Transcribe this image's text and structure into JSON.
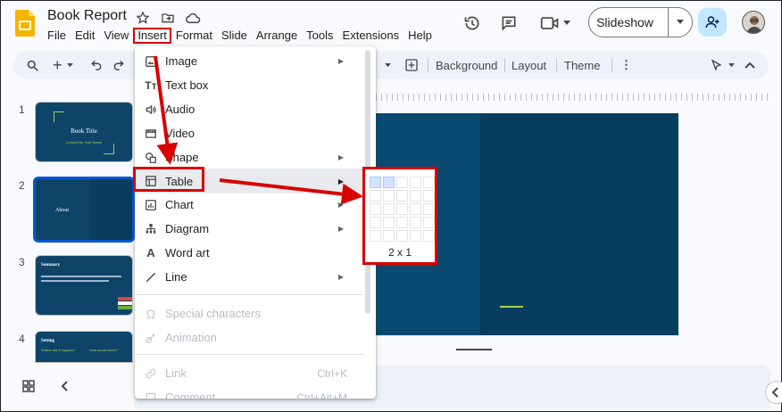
{
  "app": {
    "doc_title": "Book Report"
  },
  "menu_bar": {
    "items": [
      "File",
      "Edit",
      "View",
      "Insert",
      "Format",
      "Slide",
      "Arrange",
      "Tools",
      "Extensions",
      "Help"
    ],
    "active": "Insert"
  },
  "header_actions": {
    "slideshow_label": "Slideshow"
  },
  "toolbar": {
    "background_label": "Background",
    "layout_label": "Layout",
    "theme_label": "Theme"
  },
  "slides": [
    {
      "number": "1",
      "title": "Book Title",
      "subtitle": "A report by Your Name"
    },
    {
      "number": "2",
      "title": "About"
    },
    {
      "number": "3",
      "title": "Summary"
    },
    {
      "number": "4",
      "title": "Setting",
      "col1": "Where did it happen?",
      "col2": "How about when?"
    }
  ],
  "insert_menu": {
    "items": [
      {
        "label": "Image",
        "icon": "image-icon",
        "submenu": true
      },
      {
        "label": "Text box",
        "icon": "text-box-icon",
        "submenu": false
      },
      {
        "label": "Audio",
        "icon": "audio-icon",
        "submenu": false
      },
      {
        "label": "Video",
        "icon": "video-icon",
        "submenu": false
      },
      {
        "label": "Shape",
        "icon": "shape-icon",
        "submenu": true
      },
      {
        "label": "Table",
        "icon": "table-icon",
        "submenu": true,
        "highlighted": true
      },
      {
        "label": "Chart",
        "icon": "chart-icon",
        "submenu": true
      },
      {
        "label": "Diagram",
        "icon": "diagram-icon",
        "submenu": true
      },
      {
        "label": "Word art",
        "icon": "word-art-icon",
        "submenu": false
      },
      {
        "label": "Line",
        "icon": "line-icon",
        "submenu": true
      },
      {
        "label": "Special characters",
        "icon": "omega-icon",
        "disabled": true
      },
      {
        "label": "Animation",
        "icon": "animation-icon",
        "disabled": true
      },
      {
        "label": "Link",
        "icon": "link-icon",
        "disabled": true,
        "shortcut": "Ctrl+K"
      },
      {
        "label": "Comment",
        "icon": "comment-icon",
        "disabled": true,
        "shortcut": "Ctrl+Alt+M"
      }
    ]
  },
  "table_picker": {
    "size_label": "2 x 1",
    "selected_cols": 2,
    "selected_rows": 1
  },
  "colors": {
    "highlight_red": "#d90000",
    "slide_bg": "#073e60",
    "accent_green": "#a3d14a",
    "share_blue": "#c2e7ff"
  }
}
